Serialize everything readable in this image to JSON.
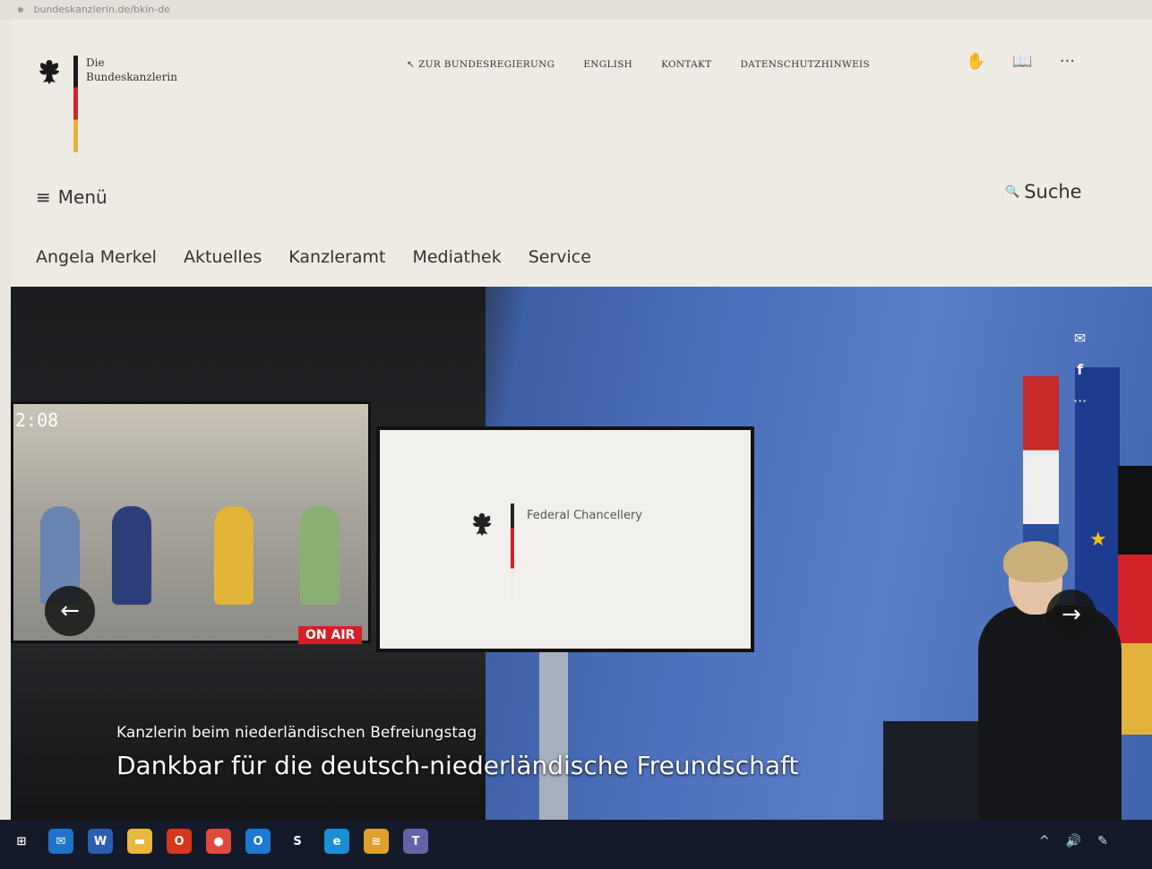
{
  "browser": {
    "url": "bundeskanzlerin.de/bkin-de"
  },
  "header": {
    "logo_line1": "Die",
    "logo_line2": "Bundeskanzlerin",
    "top_links": [
      {
        "label": "ZUR BUNDESREGIERUNG",
        "icon": "arrow-up-left-icon"
      },
      {
        "label": "ENGLISH"
      },
      {
        "label": "KONTAKT"
      },
      {
        "label": "DATENSCHUTZHINWEIS"
      }
    ],
    "top_icons": [
      "sign-language-icon",
      "easy-language-icon",
      "more-icon"
    ],
    "menu_label": "Menü",
    "search_label": "Suche",
    "main_nav": [
      "Angela Merkel",
      "Aktuelles",
      "Kanzleramt",
      "Mediathek",
      "Service"
    ]
  },
  "hero": {
    "screen_clock": "2:08",
    "on_air": "ON AIR",
    "screen_text": "Federal Chancellery",
    "kicker": "Kanzlerin beim niederländischen Befreiungstag",
    "headline": "Dankbar für die deutsch-niederländische Freundschaft",
    "share_icons": [
      "mail-icon",
      "facebook-icon",
      "more-icon"
    ],
    "arrow_prev": "←",
    "arrow_next": "→"
  },
  "taskbar": {
    "apps": [
      {
        "name": "task-view",
        "bg": "#141a2a",
        "glyph": "⊞"
      },
      {
        "name": "mail",
        "bg": "#1e74c9",
        "glyph": "✉"
      },
      {
        "name": "word",
        "bg": "#2b5fb4",
        "glyph": "W"
      },
      {
        "name": "file-explorer",
        "bg": "#e7b83c",
        "glyph": "▬"
      },
      {
        "name": "office",
        "bg": "#d7371b",
        "glyph": "O"
      },
      {
        "name": "chrome",
        "bg": "#e04a3c",
        "glyph": "●"
      },
      {
        "name": "outlook",
        "bg": "#1b79d0",
        "glyph": "O"
      },
      {
        "name": "skype-or-sway",
        "bg": "#141a2a",
        "glyph": "S"
      },
      {
        "name": "edge",
        "bg": "#1a8fd6",
        "glyph": "e"
      },
      {
        "name": "spotify",
        "bg": "#e0a12b",
        "glyph": "≋"
      },
      {
        "name": "teams",
        "bg": "#6264a7",
        "glyph": "T"
      }
    ],
    "tray": [
      "^",
      "🔊",
      "✎"
    ]
  }
}
